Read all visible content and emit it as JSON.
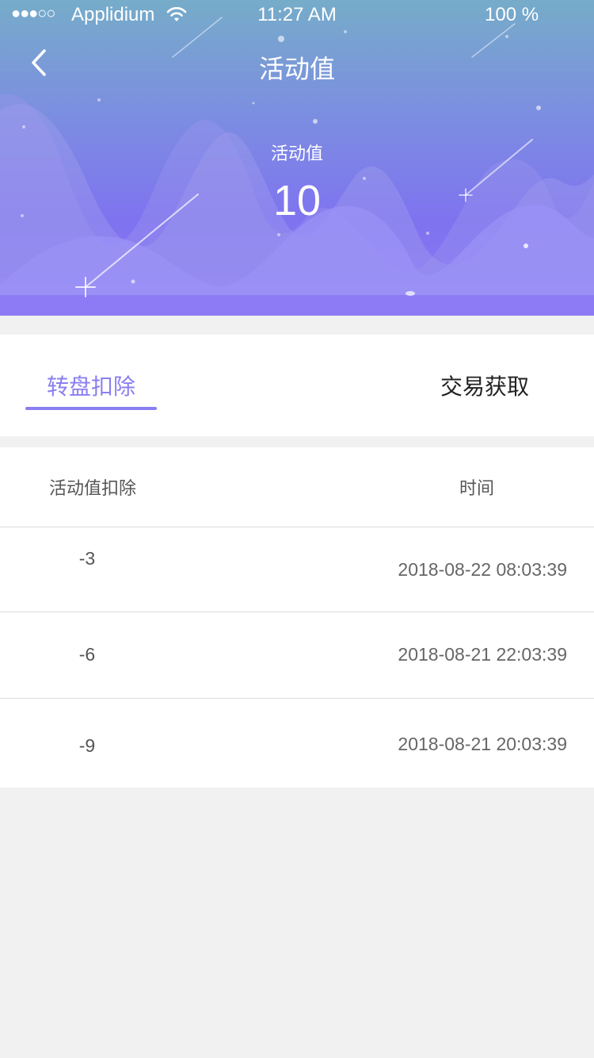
{
  "status_bar": {
    "signal": "●●●○○",
    "carrier": "Applidium",
    "time": "11:27 AM",
    "battery": "100 %"
  },
  "nav": {
    "title": "活动值",
    "back_icon": "chevron-left-icon"
  },
  "summary": {
    "label": "活动值",
    "value": "10"
  },
  "tabs": [
    {
      "label": "转盘扣除",
      "active": true
    },
    {
      "label": "交易获取",
      "active": false
    }
  ],
  "table": {
    "headers": [
      "活动值扣除",
      "时间"
    ],
    "rows": [
      {
        "amount": "-3",
        "time": "2018-08-22 08:03:39"
      },
      {
        "amount": "-6",
        "time": "2018-08-21 22:03:39"
      },
      {
        "amount": "-9",
        "time": "2018-08-21 20:03:39"
      }
    ]
  },
  "colors": {
    "accent": "#8a7ff0",
    "hero_top": "#76acc9",
    "hero_bottom": "#8a76f5",
    "background": "#f1f1f1"
  }
}
